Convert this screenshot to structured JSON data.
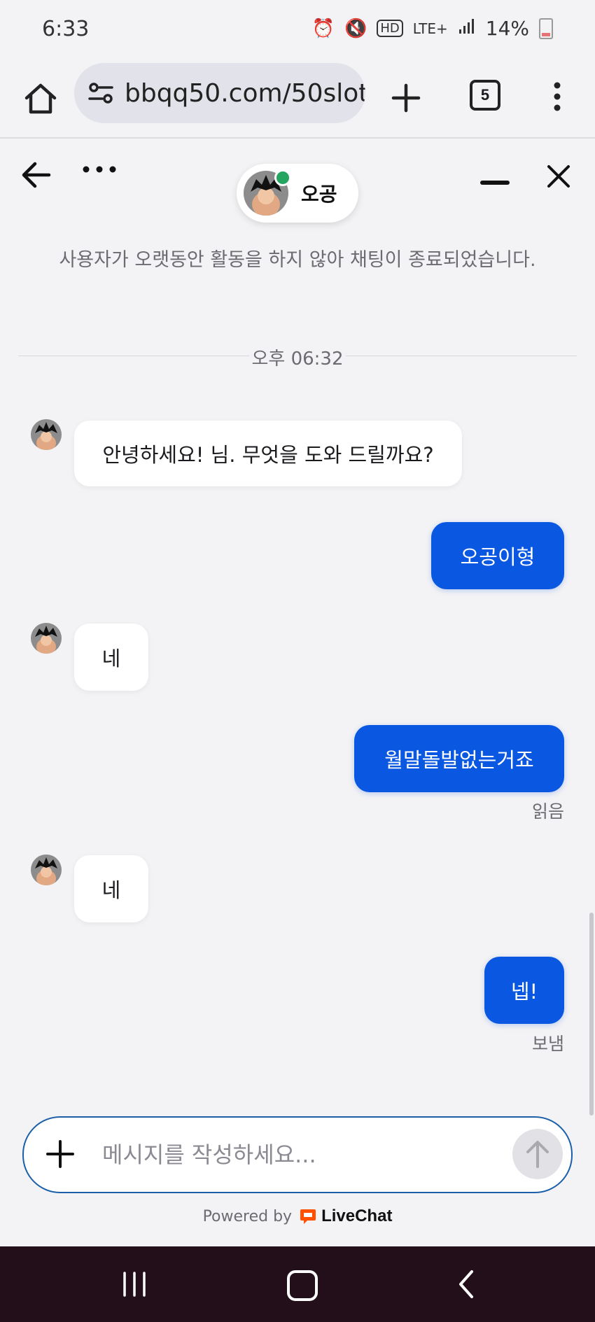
{
  "status": {
    "time": "6:33",
    "battery": "14%",
    "network": "LTE+"
  },
  "browser": {
    "url": "bbqq50.com/50slot_",
    "tab_count": "5"
  },
  "chat": {
    "agent_name": "오공",
    "system_message": "사용자가 오랫동안 활동을 하지 않아 채팅이 종료되었습니다.",
    "timestamp": "오후 06:32",
    "messages": [
      {
        "from": "agent",
        "text": "안녕하세요! 님. 무엇을 도와 드릴까요?"
      },
      {
        "from": "user",
        "text": "오공이형"
      },
      {
        "from": "agent",
        "text": "네"
      },
      {
        "from": "user",
        "text": "월말돌발없는거죠",
        "status": "읽음"
      },
      {
        "from": "agent",
        "text": "네"
      },
      {
        "from": "user",
        "text": "넵!",
        "status": "보냄"
      }
    ]
  },
  "composer": {
    "placeholder": "메시지를 작성하세요..."
  },
  "footer": {
    "powered_by": "Powered by",
    "brand": "LiveChat"
  },
  "colors": {
    "accent": "#0a58e2",
    "online": "#25a55f",
    "livechat": "#ff5100"
  }
}
